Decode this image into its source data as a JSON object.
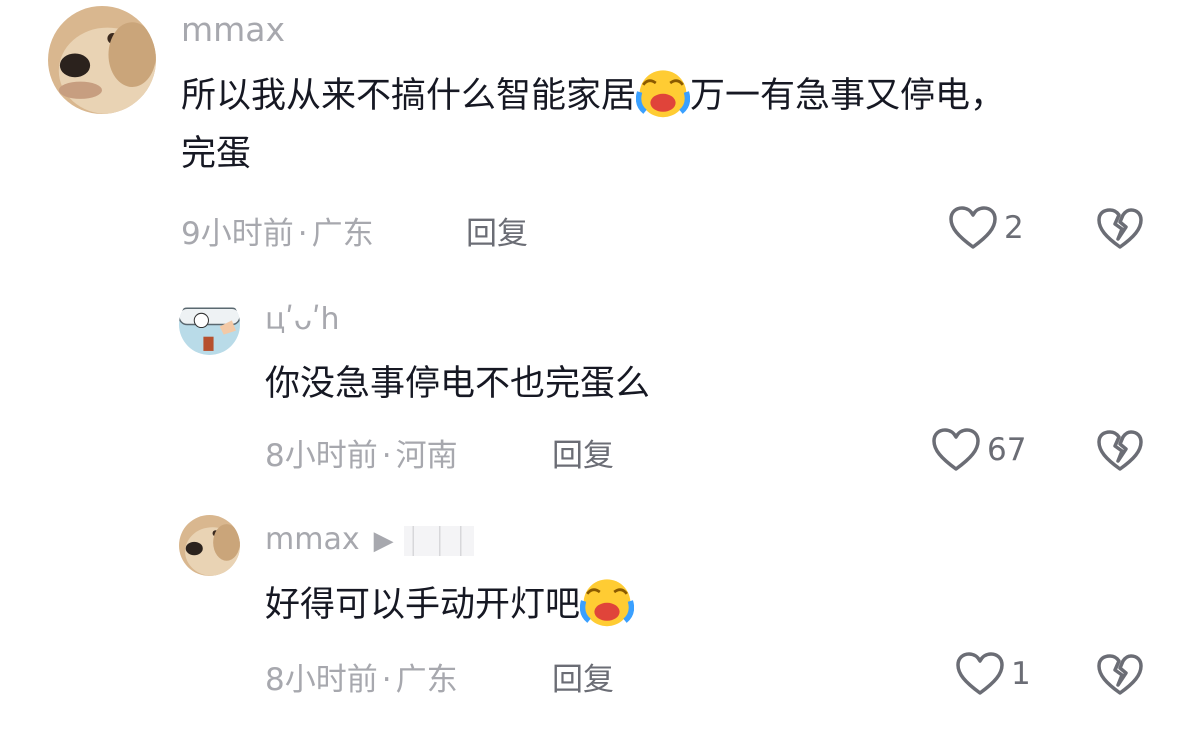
{
  "comments": [
    {
      "username": "mmax",
      "text_before": "所以我从来不搞什么智能家居",
      "text_after": "万一有急事又停电，",
      "text_line2": "完蛋",
      "time": "9小时前",
      "separator": "·",
      "location": "广东",
      "reply_label": "回复",
      "likes": "2",
      "emoji": "crying-laughing-emoji"
    },
    {
      "username": "цʹᴗʹh",
      "text": "你没急事停电不也完蛋么",
      "time": "8小时前",
      "separator": "·",
      "location": "河南",
      "reply_label": "回复",
      "likes": "67"
    },
    {
      "username": "mmax",
      "reply_arrow": "▶",
      "text": "好得可以手动开灯吧",
      "time": "8小时前",
      "separator": "·",
      "location": "广东",
      "reply_label": "回复",
      "likes": "1",
      "emoji": "crying-laughing-emoji"
    }
  ],
  "colors": {
    "text": "#161823",
    "secondary": "#a7a8ae",
    "action": "#6b6d75"
  }
}
